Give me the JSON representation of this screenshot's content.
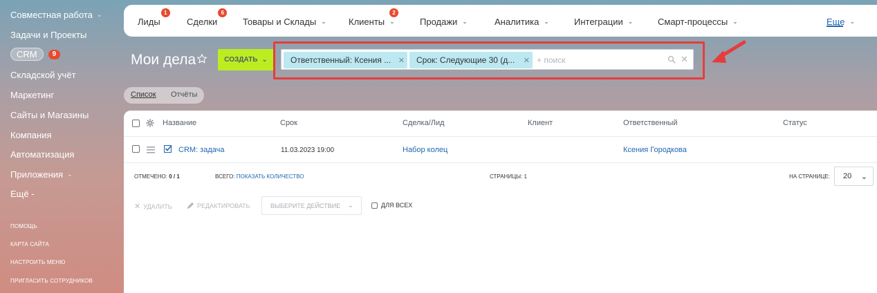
{
  "sidebar": {
    "items": [
      {
        "label": "Совместная работа",
        "chevron": true
      },
      {
        "label": "Задачи и Проекты"
      },
      {
        "label": "CRM",
        "badge": "9"
      },
      {
        "label": "Складской учёт"
      },
      {
        "label": "Маркетинг"
      },
      {
        "label": "Сайты и Магазины"
      },
      {
        "label": "Компания"
      },
      {
        "label": "Автоматизация"
      },
      {
        "label": "Приложения",
        "chevron": true
      },
      {
        "label": "Ещё -"
      }
    ],
    "footer": [
      "ПОМОЩЬ",
      "КАРТА САЙТА",
      "НАСТРОИТЬ МЕНЮ",
      "ПРИГЛАСИТЬ СОТРУДНИКОВ"
    ]
  },
  "topnav": {
    "tabs": [
      {
        "label": "Лиды",
        "badge": "1"
      },
      {
        "label": "Сделки",
        "badge": "6"
      },
      {
        "label": "Товары и Склады",
        "chevron": true
      },
      {
        "label": "Клиенты",
        "badge": "2",
        "chevron": true
      },
      {
        "label": "Продажи",
        "chevron": true
      },
      {
        "label": "Аналитика",
        "chevron": true
      },
      {
        "label": "Интеграции",
        "chevron": true
      },
      {
        "label": "Смарт-процессы",
        "chevron": true
      }
    ],
    "more_label": "Еще"
  },
  "header": {
    "title": "Мои дела",
    "create_label": "СОЗДАТЬ"
  },
  "filter": {
    "chips": [
      "Ответственный: Ксения ...",
      "Срок: Следующие 30 (д..."
    ],
    "search_placeholder": "+ поиск"
  },
  "view_tabs": [
    "Список",
    "Отчёты"
  ],
  "grid": {
    "columns": [
      "Название",
      "Срок",
      "Сделка/Лид",
      "Клиент",
      "Ответственный",
      "Статус"
    ],
    "rows": [
      {
        "title": "CRM: задача",
        "deadline": "11.03.2023 19:00",
        "deal": "Набор колец",
        "client": "",
        "responsible": "Ксения Городкова",
        "status": ""
      }
    ]
  },
  "footer": {
    "checked_label": "ОТМЕЧЕНО:",
    "checked_value": "0 / 1",
    "total_label": "ВСЕГО:",
    "total_link": "ПОКАЗАТЬ КОЛИЧЕСТВО",
    "pages_label": "СТРАНИЦЫ:",
    "pages_value": "1",
    "per_page_label": "НА СТРАНИЦЕ:",
    "per_page_value": "20"
  },
  "actions": {
    "delete_label": "УДАЛИТЬ",
    "edit_label": "РЕДАКТИРОВАТЬ",
    "select_action_label": "ВЫБЕРИТЕ ДЕЙСТВИЕ",
    "for_all_label": "ДЛЯ ВСЕХ"
  },
  "colors": {
    "accent": "#2067b0",
    "create_button": "#bbed21",
    "badge": "#e8492f",
    "filter_chip": "#bce8f1",
    "highlight_frame": "#e53d3d"
  }
}
